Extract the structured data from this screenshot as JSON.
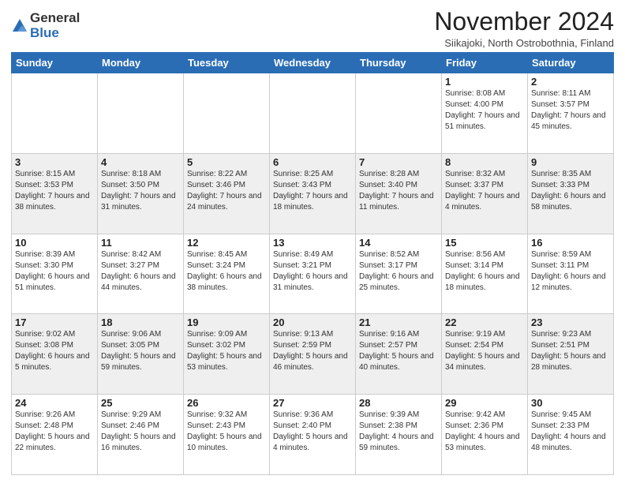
{
  "logo": {
    "general": "General",
    "blue": "Blue"
  },
  "header": {
    "month": "November 2024",
    "location": "Siikajoki, North Ostrobothnia, Finland"
  },
  "weekdays": [
    "Sunday",
    "Monday",
    "Tuesday",
    "Wednesday",
    "Thursday",
    "Friday",
    "Saturday"
  ],
  "rows": [
    [
      {
        "day": "",
        "info": ""
      },
      {
        "day": "",
        "info": ""
      },
      {
        "day": "",
        "info": ""
      },
      {
        "day": "",
        "info": ""
      },
      {
        "day": "",
        "info": ""
      },
      {
        "day": "1",
        "info": "Sunrise: 8:08 AM\nSunset: 4:00 PM\nDaylight: 7 hours and 51 minutes."
      },
      {
        "day": "2",
        "info": "Sunrise: 8:11 AM\nSunset: 3:57 PM\nDaylight: 7 hours and 45 minutes."
      }
    ],
    [
      {
        "day": "3",
        "info": "Sunrise: 8:15 AM\nSunset: 3:53 PM\nDaylight: 7 hours and 38 minutes."
      },
      {
        "day": "4",
        "info": "Sunrise: 8:18 AM\nSunset: 3:50 PM\nDaylight: 7 hours and 31 minutes."
      },
      {
        "day": "5",
        "info": "Sunrise: 8:22 AM\nSunset: 3:46 PM\nDaylight: 7 hours and 24 minutes."
      },
      {
        "day": "6",
        "info": "Sunrise: 8:25 AM\nSunset: 3:43 PM\nDaylight: 7 hours and 18 minutes."
      },
      {
        "day": "7",
        "info": "Sunrise: 8:28 AM\nSunset: 3:40 PM\nDaylight: 7 hours and 11 minutes."
      },
      {
        "day": "8",
        "info": "Sunrise: 8:32 AM\nSunset: 3:37 PM\nDaylight: 7 hours and 4 minutes."
      },
      {
        "day": "9",
        "info": "Sunrise: 8:35 AM\nSunset: 3:33 PM\nDaylight: 6 hours and 58 minutes."
      }
    ],
    [
      {
        "day": "10",
        "info": "Sunrise: 8:39 AM\nSunset: 3:30 PM\nDaylight: 6 hours and 51 minutes."
      },
      {
        "day": "11",
        "info": "Sunrise: 8:42 AM\nSunset: 3:27 PM\nDaylight: 6 hours and 44 minutes."
      },
      {
        "day": "12",
        "info": "Sunrise: 8:45 AM\nSunset: 3:24 PM\nDaylight: 6 hours and 38 minutes."
      },
      {
        "day": "13",
        "info": "Sunrise: 8:49 AM\nSunset: 3:21 PM\nDaylight: 6 hours and 31 minutes."
      },
      {
        "day": "14",
        "info": "Sunrise: 8:52 AM\nSunset: 3:17 PM\nDaylight: 6 hours and 25 minutes."
      },
      {
        "day": "15",
        "info": "Sunrise: 8:56 AM\nSunset: 3:14 PM\nDaylight: 6 hours and 18 minutes."
      },
      {
        "day": "16",
        "info": "Sunrise: 8:59 AM\nSunset: 3:11 PM\nDaylight: 6 hours and 12 minutes."
      }
    ],
    [
      {
        "day": "17",
        "info": "Sunrise: 9:02 AM\nSunset: 3:08 PM\nDaylight: 6 hours and 5 minutes."
      },
      {
        "day": "18",
        "info": "Sunrise: 9:06 AM\nSunset: 3:05 PM\nDaylight: 5 hours and 59 minutes."
      },
      {
        "day": "19",
        "info": "Sunrise: 9:09 AM\nSunset: 3:02 PM\nDaylight: 5 hours and 53 minutes."
      },
      {
        "day": "20",
        "info": "Sunrise: 9:13 AM\nSunset: 2:59 PM\nDaylight: 5 hours and 46 minutes."
      },
      {
        "day": "21",
        "info": "Sunrise: 9:16 AM\nSunset: 2:57 PM\nDaylight: 5 hours and 40 minutes."
      },
      {
        "day": "22",
        "info": "Sunrise: 9:19 AM\nSunset: 2:54 PM\nDaylight: 5 hours and 34 minutes."
      },
      {
        "day": "23",
        "info": "Sunrise: 9:23 AM\nSunset: 2:51 PM\nDaylight: 5 hours and 28 minutes."
      }
    ],
    [
      {
        "day": "24",
        "info": "Sunrise: 9:26 AM\nSunset: 2:48 PM\nDaylight: 5 hours and 22 minutes."
      },
      {
        "day": "25",
        "info": "Sunrise: 9:29 AM\nSunset: 2:46 PM\nDaylight: 5 hours and 16 minutes."
      },
      {
        "day": "26",
        "info": "Sunrise: 9:32 AM\nSunset: 2:43 PM\nDaylight: 5 hours and 10 minutes."
      },
      {
        "day": "27",
        "info": "Sunrise: 9:36 AM\nSunset: 2:40 PM\nDaylight: 5 hours and 4 minutes."
      },
      {
        "day": "28",
        "info": "Sunrise: 9:39 AM\nSunset: 2:38 PM\nDaylight: 4 hours and 59 minutes."
      },
      {
        "day": "29",
        "info": "Sunrise: 9:42 AM\nSunset: 2:36 PM\nDaylight: 4 hours and 53 minutes."
      },
      {
        "day": "30",
        "info": "Sunrise: 9:45 AM\nSunset: 2:33 PM\nDaylight: 4 hours and 48 minutes."
      }
    ]
  ]
}
